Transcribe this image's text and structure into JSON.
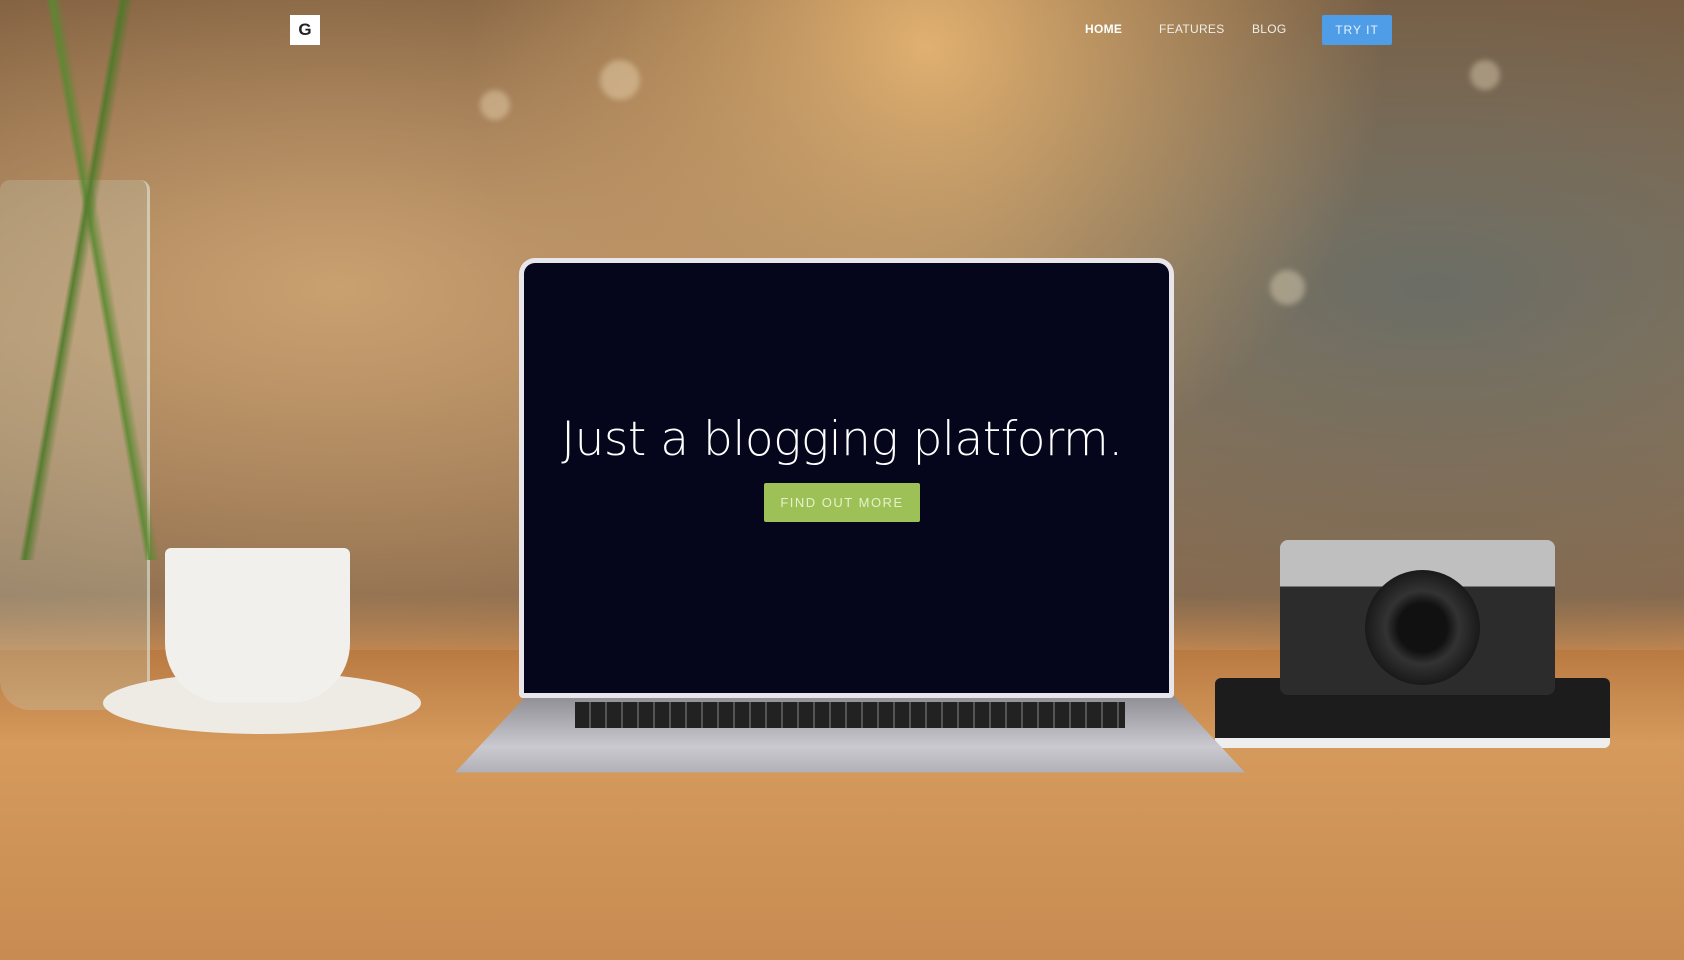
{
  "nav": {
    "logo": "G",
    "items": [
      {
        "label": "HOME"
      },
      {
        "label": "FEATURES"
      },
      {
        "label": "BLOG"
      }
    ],
    "cta_label": "TRY IT"
  },
  "hero": {
    "title": "Just a blogging platform.",
    "button_label": "FIND OUT MORE"
  },
  "colors": {
    "try_button": "#4e9de6",
    "cta_button": "#9dc057",
    "screen": "#05051c"
  }
}
